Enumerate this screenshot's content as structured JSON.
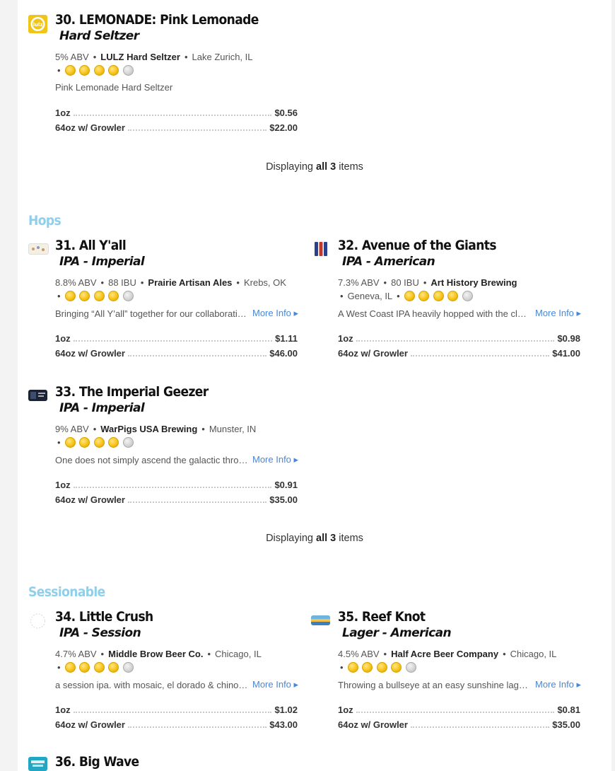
{
  "footer_pre": "Displaying",
  "footer_all": "all 3",
  "footer_post": "items",
  "more_info": "More Info ▸",
  "sections": {
    "hops": "Hops",
    "sessionable": "Sessionable"
  },
  "beers": {
    "b30": {
      "title": "30. LEMONADE: Pink Lemonade",
      "style": "Hard Seltzer",
      "abv": "5% ABV",
      "ibu": "",
      "brewery": "LULZ Hard Seltzer",
      "location": "Lake Zurich, IL",
      "rating": 4,
      "desc": "Pink Lemonade Hard Seltzer",
      "sizes": [
        {
          "size": "1oz",
          "price": "$0.56"
        },
        {
          "size": "64oz w/ Growler",
          "price": "$22.00"
        }
      ]
    },
    "b31": {
      "title": "31. All Y'all",
      "style": "IPA - Imperial",
      "abv": "8.8% ABV",
      "ibu": "88 IBU",
      "brewery": "Prairie Artisan Ales",
      "location": "Krebs, OK",
      "rating": 4,
      "desc": "Bringing “All Y’all” together for our collaboration brew",
      "sizes": [
        {
          "size": "1oz",
          "price": "$1.11"
        },
        {
          "size": "64oz w/ Growler",
          "price": "$46.00"
        }
      ]
    },
    "b32": {
      "title": "32. Avenue of the Giants",
      "style": "IPA - American",
      "abv": "7.3% ABV",
      "ibu": "80 IBU",
      "brewery": "Art History Brewing",
      "location": "Geneva, IL",
      "rating": 4,
      "desc": "A West Coast IPA heavily hopped with the classic varieties",
      "sizes": [
        {
          "size": "1oz",
          "price": "$0.98"
        },
        {
          "size": "64oz w/ Growler",
          "price": "$41.00"
        }
      ]
    },
    "b33": {
      "title": "33. The Imperial Geezer",
      "style": "IPA - Imperial",
      "abv": "9% ABV",
      "ibu": "",
      "brewery": "WarPigs USA Brewing",
      "location": "Munster, IN",
      "rating": 4,
      "desc": "One does not simply ascend the galactic throne without hops",
      "sizes": [
        {
          "size": "1oz",
          "price": "$0.91"
        },
        {
          "size": "64oz w/ Growler",
          "price": "$35.00"
        }
      ]
    },
    "b34": {
      "title": "34. Little Crush",
      "style": "IPA - Session",
      "abv": "4.7% ABV",
      "ibu": "",
      "brewery": "Middle Brow Beer Co.",
      "location": "Chicago, IL",
      "rating": 4,
      "desc": "a session ipa. with mosaic, el dorado & chinook hops",
      "sizes": [
        {
          "size": "1oz",
          "price": "$1.02"
        },
        {
          "size": "64oz w/ Growler",
          "price": "$43.00"
        }
      ]
    },
    "b35": {
      "title": "35. Reef Knot",
      "style": "Lager - American",
      "abv": "4.5% ABV",
      "ibu": "",
      "brewery": "Half Acre Beer Company",
      "location": "Chicago, IL",
      "rating": 4,
      "desc": "Throwing a bullseye at an easy sunshine lager for summer",
      "sizes": [
        {
          "size": "1oz",
          "price": "$0.81"
        },
        {
          "size": "64oz w/ Growler",
          "price": "$35.00"
        }
      ]
    },
    "b36": {
      "title": "36. Big Wave"
    }
  }
}
